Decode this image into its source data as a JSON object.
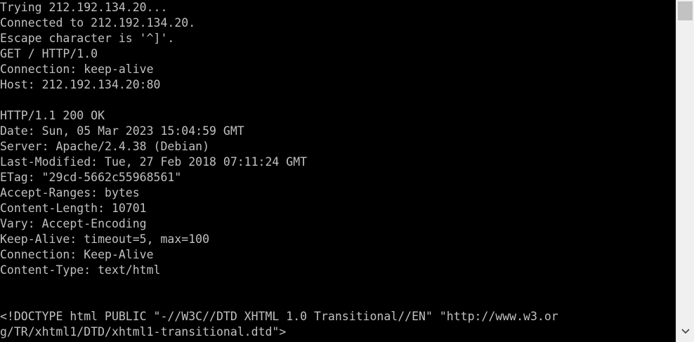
{
  "terminal": {
    "lines": [
      "Trying 212.192.134.20...",
      "Connected to 212.192.134.20.",
      "Escape character is '^]'.",
      "GET / HTTP/1.0",
      "Connection: keep-alive",
      "Host: 212.192.134.20:80",
      "",
      "HTTP/1.1 200 OK",
      "Date: Sun, 05 Mar 2023 15:04:59 GMT",
      "Server: Apache/2.4.38 (Debian)",
      "Last-Modified: Tue, 27 Feb 2018 07:11:24 GMT",
      "ETag: \"29cd-5662c55968561\"",
      "Accept-Ranges: bytes",
      "Content-Length: 10701",
      "Vary: Accept-Encoding",
      "Keep-Alive: timeout=5, max=100",
      "Connection: Keep-Alive",
      "Content-Type: text/html",
      "",
      "",
      "<!DOCTYPE html PUBLIC \"-//W3C//DTD XHTML 1.0 Transitional//EN\" \"http://www.w3.or",
      "g/TR/xhtml1/DTD/xhtml1-transitional.dtd\">"
    ]
  },
  "scrollbar": {
    "down_icon": "chevron-down-icon"
  },
  "colors": {
    "background": "#000000",
    "text": "#c0c0c0",
    "scrollbar_track": "#f0f0f0",
    "scrollbar_thumb": "#c2c2c2"
  }
}
